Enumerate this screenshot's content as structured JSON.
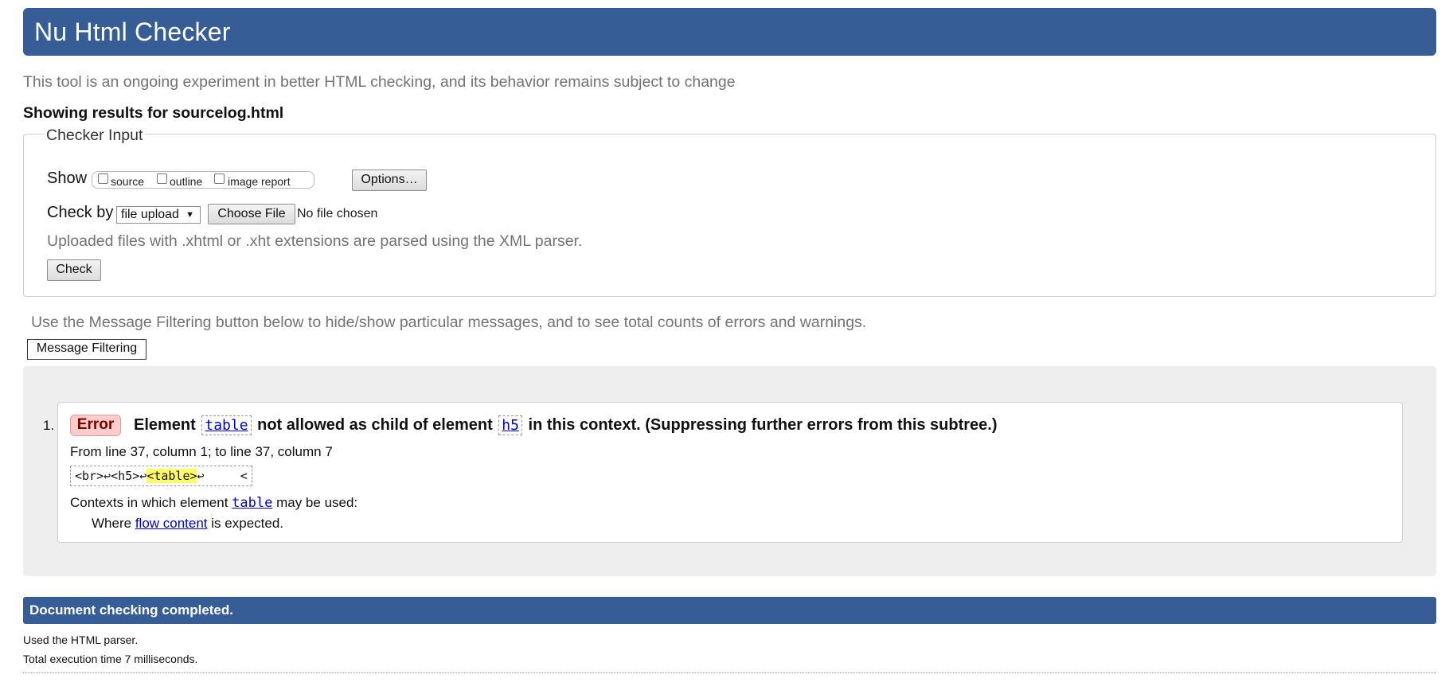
{
  "header": {
    "title": "Nu Html Checker"
  },
  "intro": "This tool is an ongoing experiment in better HTML checking, and its behavior remains subject to change",
  "results_for": "Showing results for sourcelog.html",
  "checker_input": {
    "legend": "Checker Input",
    "show_label": "Show",
    "show_options": [
      "source",
      "outline",
      "image report"
    ],
    "options_button": "Options…",
    "check_by_label": "Check by",
    "check_by_value": "file upload",
    "choose_file_button": "Choose File",
    "no_file_text": "No file chosen",
    "xml_note": "Uploaded files with .xhtml or .xht extensions are parsed using the XML parser.",
    "check_button": "Check"
  },
  "filtering": {
    "note": "Use the Message Filtering button below to hide/show particular messages, and to see total counts of errors and warnings.",
    "button": "Message Filtering"
  },
  "messages": [
    {
      "number": "1.",
      "type": "Error",
      "text_before": "Element",
      "code1": "table",
      "text_middle": "not allowed as child of element",
      "code2": "h5",
      "text_after": "in this context. (Suppressing further errors from this subtree.)",
      "location": "From line 37, column 1; to line 37, column 7",
      "extract_before": "<br>↩<h5>↩",
      "extract_highlight": "<table>",
      "extract_after": "↩     <",
      "contexts_prefix": "Contexts in which element",
      "contexts_code": "table",
      "contexts_suffix": "may be used:",
      "where_prefix": "Where",
      "where_link": "flow content",
      "where_suffix": "is expected."
    }
  ],
  "footer": {
    "status": "Document checking completed.",
    "parser": "Used the HTML parser.",
    "time": "Total execution time 7 milliseconds."
  }
}
